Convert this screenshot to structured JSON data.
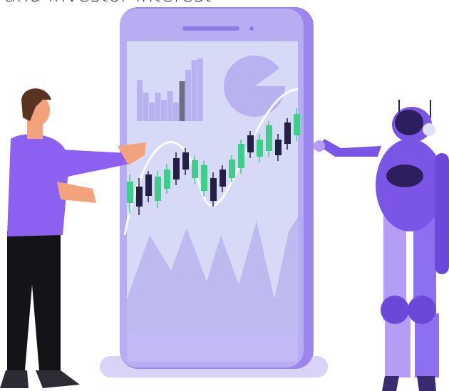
{
  "caption": {
    "text": "and investor interest"
  },
  "icons": {
    "person": "person-presenting-icon",
    "robot": "robot-presenting-icon",
    "phone": "smartphone-icon"
  },
  "colors": {
    "phone_body": "#8f7be8",
    "screen_bg": "#d6daf7",
    "bull_candle": "#3fce8a",
    "bear_candle": "#232046",
    "person_shirt": "#8c60f0",
    "robot_body": "#7a55e6"
  },
  "chart_data": {
    "type": "candlestick",
    "title": "",
    "xlabel": "",
    "ylabel": "",
    "candles": [
      {
        "dir": "up",
        "open": 255,
        "close": 285,
        "high": 300,
        "low": 245
      },
      {
        "dir": "down",
        "open": 262,
        "close": 290,
        "high": 302,
        "low": 250
      },
      {
        "dir": "down",
        "open": 245,
        "close": 275,
        "high": 284,
        "low": 240
      },
      {
        "dir": "up",
        "open": 248,
        "close": 282,
        "high": 292,
        "low": 240
      },
      {
        "dir": "up",
        "open": 238,
        "close": 265,
        "high": 272,
        "low": 230
      },
      {
        "dir": "down",
        "open": 222,
        "close": 252,
        "high": 260,
        "low": 214
      },
      {
        "dir": "down",
        "open": 214,
        "close": 238,
        "high": 246,
        "low": 208
      },
      {
        "dir": "up",
        "open": 225,
        "close": 250,
        "high": 258,
        "low": 218
      },
      {
        "dir": "up",
        "open": 232,
        "close": 268,
        "high": 276,
        "low": 226
      },
      {
        "dir": "down",
        "open": 250,
        "close": 282,
        "high": 290,
        "low": 242
      },
      {
        "dir": "down",
        "open": 238,
        "close": 262,
        "high": 270,
        "low": 232
      },
      {
        "dir": "up",
        "open": 224,
        "close": 250,
        "high": 256,
        "low": 218
      },
      {
        "dir": "up",
        "open": 202,
        "close": 236,
        "high": 244,
        "low": 196
      },
      {
        "dir": "down",
        "open": 190,
        "close": 214,
        "high": 222,
        "low": 184
      },
      {
        "dir": "up",
        "open": 196,
        "close": 220,
        "high": 228,
        "low": 188
      },
      {
        "dir": "up",
        "open": 176,
        "close": 212,
        "high": 220,
        "low": 170
      },
      {
        "dir": "down",
        "open": 196,
        "close": 218,
        "high": 226,
        "low": 188
      },
      {
        "dir": "down",
        "open": 172,
        "close": 202,
        "high": 210,
        "low": 166
      },
      {
        "dir": "up",
        "open": 160,
        "close": 190,
        "high": 198,
        "low": 152
      }
    ],
    "mini_bars": [
      58,
      40,
      26,
      40,
      30,
      42,
      26,
      56,
      72,
      86,
      88
    ],
    "area_peaks": [
      85,
      175,
      130,
      180,
      90,
      220,
      120,
      210,
      200,
      240
    ]
  }
}
